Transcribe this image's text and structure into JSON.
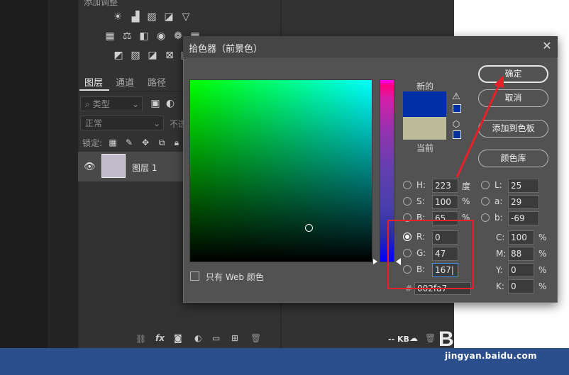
{
  "adjustments_title": "添加调整",
  "layers_panel": {
    "tabs": [
      "图层",
      "通道",
      "路径"
    ],
    "kind_filter": "类型",
    "blend_mode": "正常",
    "opacity_label": "不透",
    "lock_label": "锁定:",
    "layer_name": "图层 1",
    "doc_size": "-- KB"
  },
  "dialog": {
    "title": "拾色器（前景色）",
    "close_glyph": "✕",
    "new_label": "新的",
    "current_label": "当前",
    "buttons": {
      "ok": "确定",
      "cancel": "取消",
      "add_to_swatches": "添加到色板",
      "color_libraries": "颜色库"
    },
    "fields": {
      "H": {
        "label": "H:",
        "value": "223",
        "unit": "度"
      },
      "S": {
        "label": "S:",
        "value": "100",
        "unit": "%"
      },
      "B": {
        "label": "B:",
        "value": "65",
        "unit": "%"
      },
      "R": {
        "label": "R:",
        "value": "0"
      },
      "G": {
        "label": "G:",
        "value": "47"
      },
      "Bl": {
        "label": "B:",
        "value": "167|"
      },
      "L": {
        "label": "L:",
        "value": "25"
      },
      "a": {
        "label": "a:",
        "value": "29"
      },
      "b": {
        "label": "b:",
        "value": "-69"
      },
      "C": {
        "label": "C:",
        "value": "100",
        "unit": "%"
      },
      "M": {
        "label": "M:",
        "value": "88",
        "unit": "%"
      },
      "Y": {
        "label": "Y:",
        "value": "0",
        "unit": "%"
      },
      "K": {
        "label": "K:",
        "value": "0",
        "unit": "%"
      }
    },
    "hex": {
      "label": "#",
      "value": "002fa7"
    },
    "web_only_label": "只有 Web 颜色",
    "new_color": "#002fa7",
    "current_color": "#bcbc9b"
  },
  "watermark": {
    "logo_text": "Bai 经验",
    "url": "jingyan.baidu.com"
  }
}
